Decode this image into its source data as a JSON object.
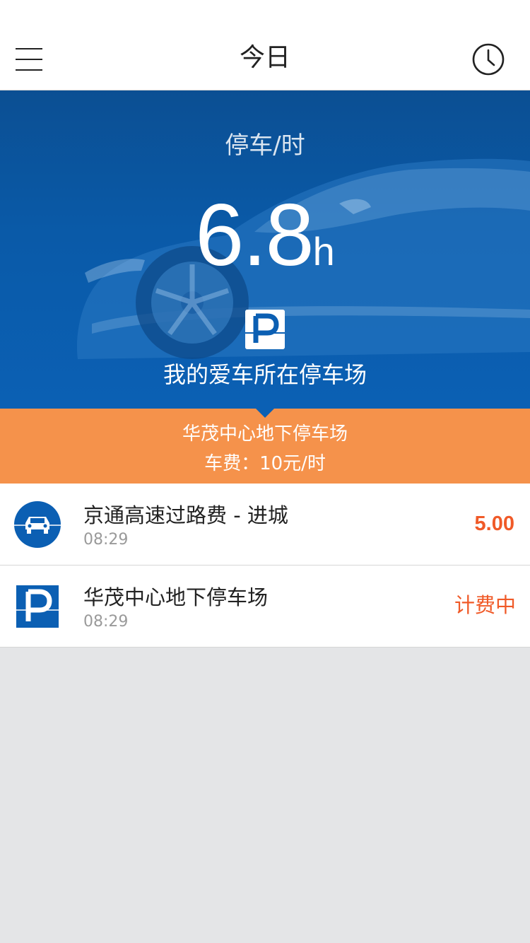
{
  "nav": {
    "title": "今日",
    "menu_icon": "hamburger-menu-icon",
    "history_icon": "clock-icon"
  },
  "hero": {
    "label": "停车/时",
    "value": "6.8",
    "unit": "h",
    "parking_icon": "parking-icon",
    "caption": "我的爱车所在停车场",
    "background": "car-silhouette",
    "colors": {
      "bg_top": "#0b4f93",
      "bg_bottom": "#0b60b4"
    }
  },
  "band": {
    "lot_name": "华茂中心地下停车场",
    "fee_text": "车费：10元/时",
    "color": "#f5924b"
  },
  "records": [
    {
      "icon": "car-toll-icon",
      "title": "京通高速过路费 - 进城",
      "time": "08:29",
      "amount": "5.00"
    },
    {
      "icon": "parking-icon",
      "title": "华茂中心地下停车场",
      "time": "08:29",
      "status": "计费中"
    }
  ],
  "accent_color": "#f05a28"
}
